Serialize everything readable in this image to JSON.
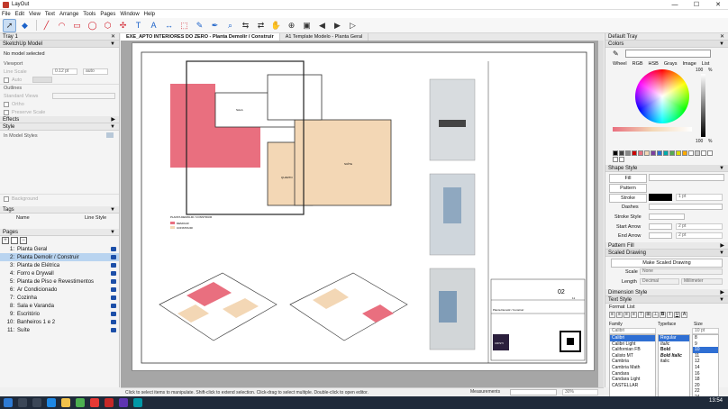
{
  "window": {
    "title": "LayOut",
    "minimize": "—",
    "maximize": "☐",
    "close": "✕"
  },
  "menu": [
    "File",
    "Edit",
    "View",
    "Text",
    "Arrange",
    "Tools",
    "Pages",
    "Window",
    "Help"
  ],
  "toolbar": {
    "icons": [
      "select-icon",
      "eraser-icon",
      "line-icon",
      "arc-icon",
      "rectangle-icon",
      "circle-icon",
      "polygon-icon",
      "offset-icon",
      "text-icon",
      "label-icon",
      "dimension-icon",
      "scaled-drawing-icon",
      "paint-bucket-icon",
      "style-icon",
      "sample-icon",
      "split-icon",
      "join-icon",
      "pan-icon",
      "zoom-icon",
      "add-page-icon",
      "previous-page-icon",
      "next-page-icon",
      "presentation-icon"
    ]
  },
  "left": {
    "tray": "Tray 1",
    "sketchup": {
      "header": "SketchUp Model",
      "no_model": "No model selected",
      "viewport": "Viewport",
      "line_scale": "Line Scale",
      "line_scale_value": "0.12 pt",
      "auto": "auto",
      "auto2": "Auto",
      "outlines": "Outlines",
      "standard_views": "Standard Views",
      "ortho": "Ortho",
      "preserve_scale": "Preserve Scale",
      "effects": "Effects",
      "style": "Style",
      "in_model_styles": "In Model Styles",
      "background": "Background"
    },
    "tags": {
      "header": "Tags",
      "col_name": "Name",
      "col_linestyle": "Line Style"
    },
    "pages": {
      "header": "Pages",
      "items": [
        {
          "num": "1:",
          "label": "Planta Geral"
        },
        {
          "num": "2:",
          "label": "Planta Demolir / Construir"
        },
        {
          "num": "3:",
          "label": "Planta de Elétrica"
        },
        {
          "num": "4:",
          "label": "Forro e Drywall"
        },
        {
          "num": "5:",
          "label": "Planta de Piso e Revestimentos"
        },
        {
          "num": "6:",
          "label": "Ar Condicionado"
        },
        {
          "num": "7:",
          "label": "Cozinha"
        },
        {
          "num": "8:",
          "label": "Sala e Varanda"
        },
        {
          "num": "9:",
          "label": "Escritório"
        },
        {
          "num": "10:",
          "label": "Banheiros 1 e 2"
        },
        {
          "num": "11:",
          "label": "Suíte"
        }
      ]
    }
  },
  "document": {
    "tabs": [
      "EXE_APTO INTERIORES DO ZERO - Planta Demolir / Construir",
      "A1 Template Modelo - Planta Geral"
    ],
    "page_number": "02",
    "page_total": "11",
    "sheet_caption": "Planta Demolir / Construir",
    "legend": [
      "DEMOLIR",
      "CONSTRUIR"
    ],
    "plan_label": "PLANTA DEMOLIR / CONSTRUIR",
    "rooms": [
      "SALA",
      "QUARTO",
      "COZINHA",
      "ESCRITÓRIO",
      "DORMITÓRIO",
      "SUÍTE"
    ],
    "logo_text": "CRISTI"
  },
  "right": {
    "tray": "Default Tray",
    "colors": {
      "header": "Colors",
      "tabs": [
        "Wheel",
        "RGB",
        "HSB",
        "Grays",
        "Image",
        "List"
      ],
      "opacity_top": "100",
      "opacity_bottom": "100",
      "percent": "%"
    },
    "shape_style": {
      "header": "Shape Style",
      "fill": "Fill",
      "pattern": "Pattern",
      "stroke": "Stroke",
      "stroke_value": "1 pt",
      "dashes": "Dashes",
      "stroke_style": "Stroke Style",
      "start_arrow": "Start Arrow",
      "start_value": "2 pt",
      "end_arrow": "End Arrow",
      "end_value": "2 pt"
    },
    "pattern_fill": "Pattern Fill",
    "scaled_drawing": {
      "header": "Scaled Drawing",
      "make": "Make Scaled Drawing",
      "scale": "Scale",
      "scale_value": "None",
      "length": "Length",
      "length_value": "Decimal",
      "length_unit": "Millimeter"
    },
    "dimension_style": "Dimension Style",
    "text_style": {
      "header": "Text Style",
      "format": "Format",
      "list": "List",
      "family_label": "Family",
      "typeface_label": "Typeface",
      "size_label": "Size",
      "families": [
        "Calibri",
        "Calibri Light",
        "Californian FB",
        "Calisto MT",
        "Cambria",
        "",
        "Cambria Math",
        "",
        "Candara",
        "Candara Light",
        "CASTELLAR"
      ],
      "typefaces": [
        "Regular",
        "Italic",
        "Bold",
        "Bold Italic",
        "italic"
      ],
      "sizes": [
        "10 pt",
        "8",
        "9",
        "10",
        "11",
        "12",
        "14",
        "16",
        "18",
        "20",
        "22",
        "24",
        "26",
        "28",
        "36",
        "48"
      ],
      "family_selected": "Calibri",
      "size_selected": "10 pt"
    }
  },
  "status": {
    "hint": "Click to select items to manipulate. Shift-click to extend selection. Click-drag to select multiple. Double-click to open editor.",
    "measurements": "Measurements",
    "zoom": "30%"
  },
  "taskbar": {
    "time": "13:54"
  }
}
